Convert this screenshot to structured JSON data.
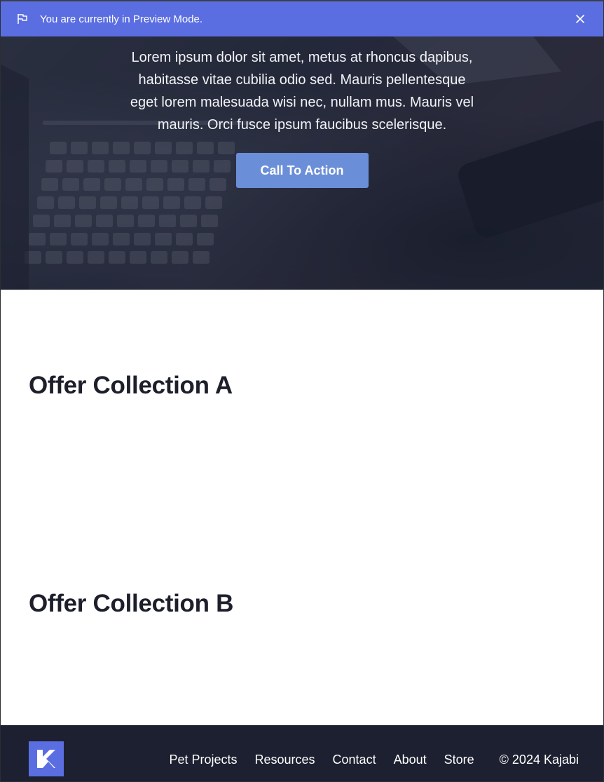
{
  "preview_bar": {
    "message": "You are currently in Preview Mode.",
    "icon": "flag-icon",
    "close_icon": "close-icon",
    "color": "#5b6ee1"
  },
  "hero": {
    "body": "Lorem ipsum dolor sit amet, metus at rhoncus dapibus, habitasse vitae cubilia odio sed. Mauris pellentesque eget lorem malesuada wisi nec, nullam mus. Mauris vel mauris. Orci fusce ipsum faucibus scelerisque.",
    "cta_label": "Call To Action",
    "cta_color": "#6b8ed8"
  },
  "offers": {
    "a_title": "Offer Collection A",
    "b_title": "Offer Collection B"
  },
  "footer": {
    "logo_icon": "kajabi-logo-icon",
    "links": [
      "Pet Projects",
      "Resources",
      "Contact",
      "About",
      "Store"
    ],
    "copyright": "© 2024 Kajabi",
    "background": "#1d2030"
  }
}
